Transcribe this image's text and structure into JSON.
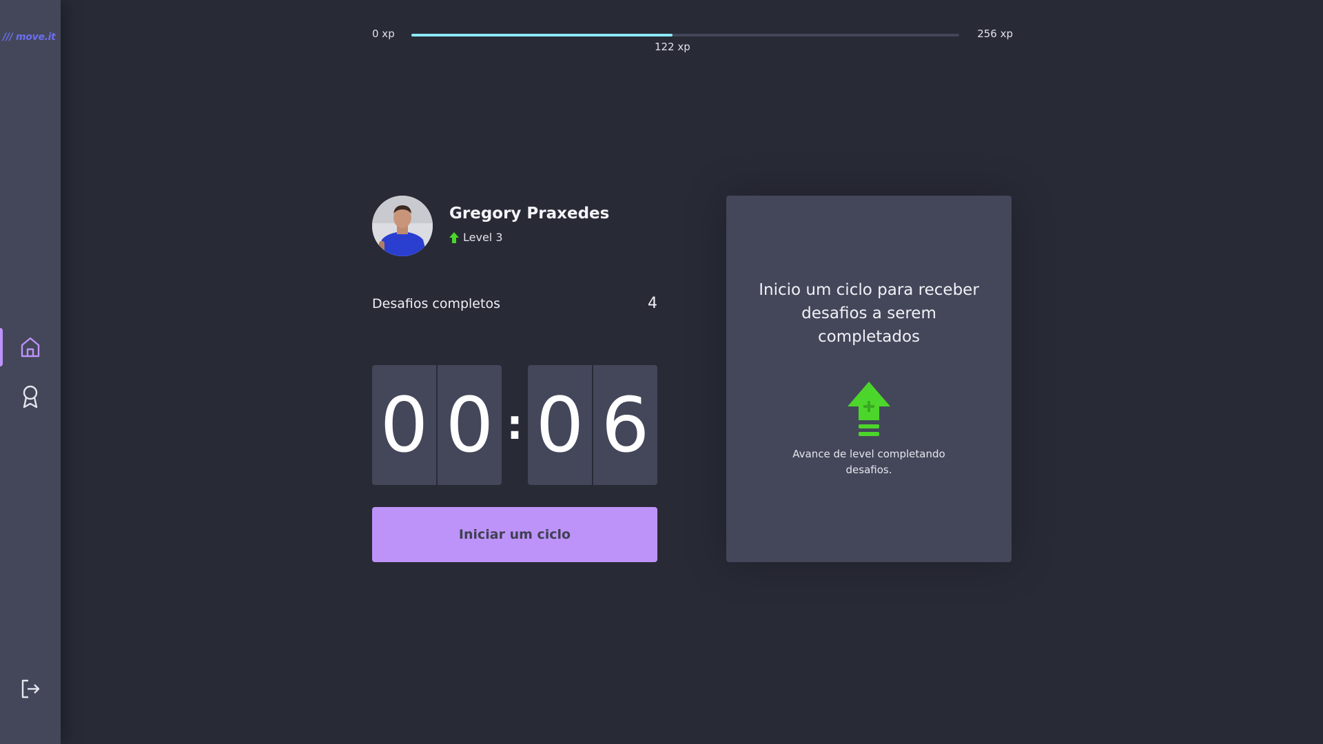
{
  "app": {
    "logo_text": "/// move.it"
  },
  "sidebar": {
    "items": [
      {
        "name": "home",
        "icon": "home-icon",
        "active": true
      },
      {
        "name": "award",
        "icon": "award-icon",
        "active": false
      }
    ],
    "logout_icon": "logout-icon"
  },
  "experience": {
    "min_label": "0 xp",
    "max_label": "256 xp",
    "current_label": "122 xp",
    "current": 122,
    "max": 256,
    "fill_color": "#8be9fd"
  },
  "profile": {
    "name": "Gregory Praxedes",
    "level_label": "Level 3"
  },
  "challenges": {
    "label": "Desafios completos",
    "count": "4"
  },
  "countdown": {
    "minutes": [
      "0",
      "0"
    ],
    "separator": ":",
    "seconds": [
      "0",
      "6"
    ]
  },
  "start_button": {
    "label": "Iniciar um ciclo",
    "color": "#bd93f9"
  },
  "challenge_box": {
    "title": "Inicio um ciclo para receber desafios a serem completados",
    "icon": "level-up-icon",
    "description": "Avance de level completando desafios."
  },
  "colors": {
    "background": "#282a36",
    "panel": "#44475a",
    "accent": "#bd93f9",
    "level_green": "#4cd62b"
  }
}
